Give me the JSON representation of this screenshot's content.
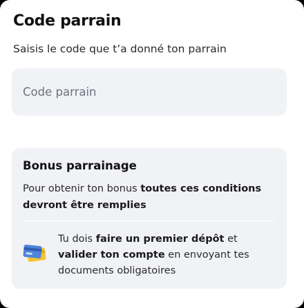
{
  "sheet": {
    "title": "Code parrain",
    "subtitle": "Saisis le code que t’a donné ton parrain"
  },
  "code_input": {
    "value": "",
    "placeholder": "Code parrain"
  },
  "bonus": {
    "title": "Bonus parrainage",
    "desc_part1": "Pour obtenir ton bonus ",
    "desc_bold": "toutes ces conditions devront être remplies",
    "condition": {
      "icon": "credit-card-icon",
      "part1": "Tu dois ",
      "bold1": "faire un premier dépôt",
      "part2": " et ",
      "bold2": "valider ton compte",
      "part3": " en envoyant tes documents obligatoires"
    }
  },
  "colors": {
    "card_back": "#f4c42e",
    "card_front": "#4f86d9",
    "field_background": "#f1f2f5"
  }
}
